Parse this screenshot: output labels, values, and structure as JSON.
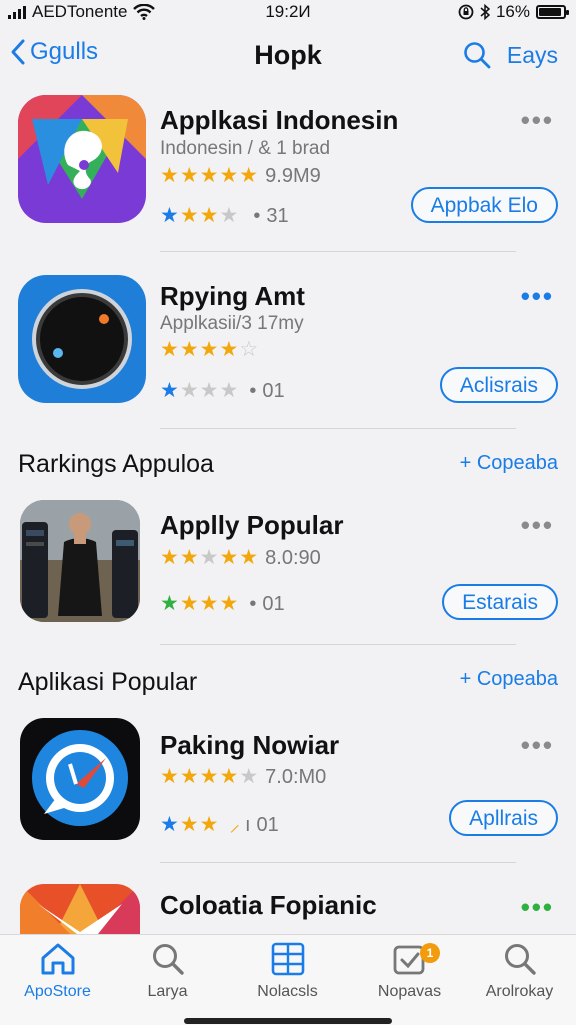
{
  "status_bar": {
    "carrier": "AEDTonente",
    "time": "19:2И",
    "battery": "16%"
  },
  "nav": {
    "back_label": "Ggulls",
    "title": "Hopk",
    "right_label": "Eays"
  },
  "apps_top": [
    {
      "name": "Applkasi Indonesin",
      "subtitle": "Indonesin / & 1 brad",
      "rating_text": "9.9M9",
      "sub_rating": "31",
      "button": "Appbak Elo"
    },
    {
      "name": "Rpying Amt",
      "subtitle": "Applkasii/3 17my",
      "sub_rating": "01",
      "button": "Aclisrais"
    }
  ],
  "section_rankings": {
    "title": "Rarkings Appuloa",
    "link": "+ Copeaba"
  },
  "apps_rank": [
    {
      "name": "Applly Popular",
      "rating_text": "8.0:90",
      "sub_rating": "01",
      "button": "Estarais"
    }
  ],
  "section_popular": {
    "title": "Aplikasi Popular",
    "link": "+ Copeaba"
  },
  "apps_popular": [
    {
      "name": "Paking Nowiar",
      "rating_text": "7.0:M0",
      "sub_rating": "01",
      "button": "Apllrais"
    },
    {
      "name": "Coloatia Fopianic"
    }
  ],
  "tabs": [
    {
      "label": "ApoStore",
      "icon": "home-icon"
    },
    {
      "label": "Larya",
      "icon": "search-icon"
    },
    {
      "label": "Nolacsls",
      "icon": "grid-icon"
    },
    {
      "label": "Nopavas",
      "icon": "updates-icon",
      "badge": "1"
    },
    {
      "label": "Arolrokay",
      "icon": "search-icon"
    }
  ],
  "colors": {
    "accent": "#1a7ce6",
    "star": "#f2a80c",
    "badge": "#f29b0c"
  }
}
